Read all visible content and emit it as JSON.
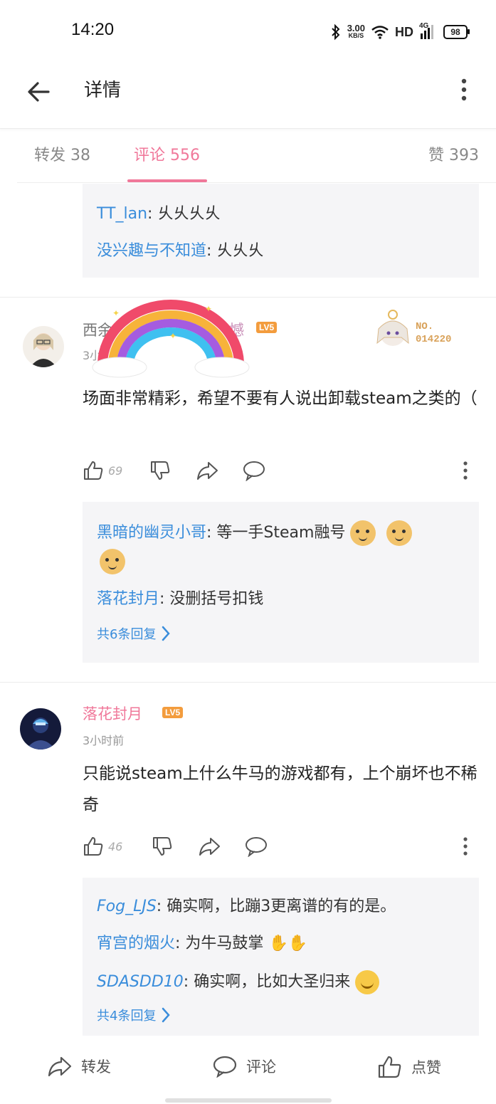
{
  "status_bar": {
    "time": "14:20",
    "net_speed_value": "3.00",
    "net_speed_unit": "KB/S",
    "hd_label": "HD",
    "signal_label": "4G",
    "battery": "98"
  },
  "header": {
    "title": "详情"
  },
  "tabs": [
    {
      "label": "转发 38"
    },
    {
      "label": "评论 556"
    },
    {
      "label": "赞 393"
    }
  ],
  "top_reply_box": {
    "replies": [
      {
        "name": "TT_lan",
        "text": "乆乆乆乆"
      },
      {
        "name": "没兴趣与不知道",
        "text": "乆乆乆"
      }
    ]
  },
  "comments": [
    {
      "username_start": "西余",
      "username_end": "憾",
      "level": "LV5",
      "time": "3小",
      "badge_number": "NO.\n014220",
      "text": "场面非常精彩，希望不要有人说出卸载steam之类的（",
      "likes": "69",
      "replies": [
        {
          "name": "黑暗的幽灵小哥",
          "text": "等一手Steam融号"
        },
        {
          "name": "落花封月",
          "text": "没删括号扣钱"
        }
      ],
      "more_replies": "共6条回复"
    },
    {
      "username": "落花封月",
      "level": "LV5",
      "time": "3小时前",
      "text": "只能说steam上什么牛马的游戏都有，上个崩坏也不稀奇",
      "likes": "46",
      "replies": [
        {
          "name": "Fog_LJS",
          "text": "确实啊，比蹦3更离谱的有的是。"
        },
        {
          "name": "宵宫的烟火",
          "text": "为牛马鼓掌"
        },
        {
          "name": "SDASDD10",
          "text": "确实啊，比如大圣归来"
        }
      ],
      "more_replies": "共4条回复"
    }
  ],
  "bottom_bar": {
    "repost": "转发",
    "comment": "评论",
    "like": "点赞"
  },
  "colors": {
    "accent": "#f0789a",
    "link": "#3a8ddb",
    "reply_bg": "#f5f5f7",
    "level_badge": "#f39c3d"
  }
}
